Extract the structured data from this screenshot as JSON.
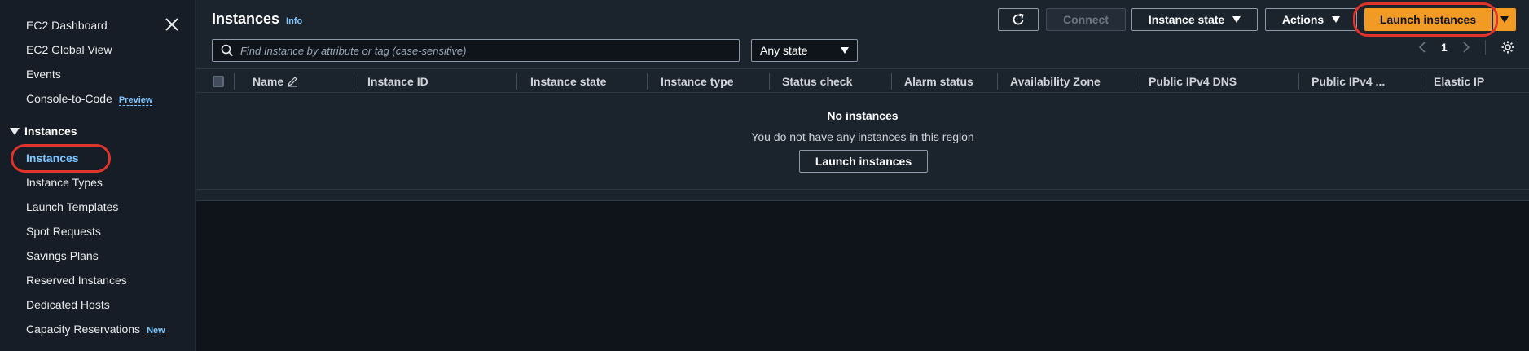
{
  "sidebar": {
    "top_items": [
      {
        "label": "EC2 Dashboard"
      },
      {
        "label": "EC2 Global View"
      },
      {
        "label": "Events"
      },
      {
        "label": "Console-to-Code",
        "badge": "Preview"
      }
    ],
    "section": {
      "label": "Instances"
    },
    "section_items": [
      {
        "label": "Instances",
        "active": true
      },
      {
        "label": "Instance Types"
      },
      {
        "label": "Launch Templates"
      },
      {
        "label": "Spot Requests"
      },
      {
        "label": "Savings Plans"
      },
      {
        "label": "Reserved Instances"
      },
      {
        "label": "Dedicated Hosts"
      },
      {
        "label": "Capacity Reservations",
        "badge": "New"
      }
    ]
  },
  "header": {
    "title": "Instances",
    "info": "Info",
    "buttons": {
      "connect": "Connect",
      "instance_state": "Instance state",
      "actions": "Actions",
      "launch": "Launch instances"
    }
  },
  "search": {
    "placeholder": "Find Instance by attribute or tag (case-sensitive)",
    "value": ""
  },
  "state_filter": {
    "selected": "Any state"
  },
  "pagination": {
    "page": "1"
  },
  "table": {
    "columns": [
      "Name",
      "Instance ID",
      "Instance state",
      "Instance type",
      "Status check",
      "Alarm status",
      "Availability Zone",
      "Public IPv4 DNS",
      "Public IPv4 ...",
      "Elastic IP"
    ],
    "empty_title": "No instances",
    "empty_desc": "You do not have any instances in this region",
    "empty_button": "Launch instances"
  },
  "colors": {
    "accent": "#f29b24",
    "link": "#7fc6ff",
    "highlight": "#e0332a"
  }
}
